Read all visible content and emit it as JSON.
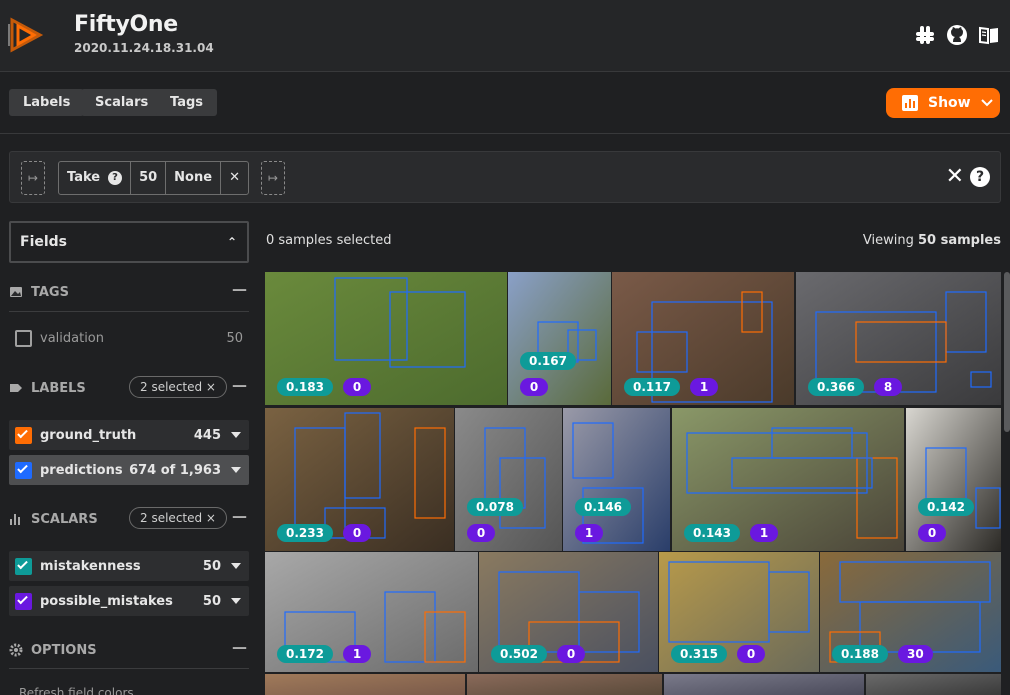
{
  "app": {
    "title": "FiftyOne",
    "version": "2020.11.24.18.31.04"
  },
  "header_icons": [
    "slack-icon",
    "github-icon",
    "docs-book-icon"
  ],
  "toolbar": {
    "labels_tab": "Labels",
    "scalars_tab": "Scalars",
    "tags_tab": "Tags",
    "show_button": "Show"
  },
  "viewbar": {
    "stage_name": "Take",
    "stage_help": "?",
    "stage_value": "50",
    "stage_seed": "None",
    "stage_remove": "✕",
    "add_icon": "↦",
    "close": "✕",
    "help": "?"
  },
  "sidebar": {
    "fields_label": "Fields",
    "tags": {
      "header": "TAGS",
      "items": [
        {
          "label": "validation",
          "count": "50"
        }
      ]
    },
    "labels": {
      "header": "LABELS",
      "badge": "2 selected ×",
      "items": [
        {
          "label": "ground_truth",
          "count": "445",
          "color": "#ff6d04"
        },
        {
          "label": "predictions",
          "count": "674 of 1,963",
          "color": "#1f6bff"
        }
      ]
    },
    "scalars": {
      "header": "SCALARS",
      "badge": "2 selected ×",
      "items": [
        {
          "label": "mistakenness",
          "count": "50",
          "color": "#0e9b98"
        },
        {
          "label": "possible_mistakes",
          "count": "50",
          "color": "#6a18e0"
        }
      ]
    },
    "options": {
      "header": "OPTIONS"
    },
    "refresh": "Refresh field colors"
  },
  "grid": {
    "selected_text": "0 samples selected",
    "viewing_prefix": "Viewing ",
    "viewing_count": "50 samples",
    "tiles": [
      {
        "mistakenness": "0.183",
        "possible_mistakes": "0"
      },
      {
        "mistakenness": "0.167",
        "possible_mistakes": "0"
      },
      {
        "mistakenness": "0.117",
        "possible_mistakes": "1"
      },
      {
        "mistakenness": "0.366",
        "possible_mistakes": "8"
      },
      {
        "mistakenness": "0.233",
        "possible_mistakes": "0"
      },
      {
        "mistakenness": "0.078",
        "possible_mistakes": "0"
      },
      {
        "mistakenness": "0.146",
        "possible_mistakes": "1"
      },
      {
        "mistakenness": "0.143",
        "possible_mistakes": "1"
      },
      {
        "mistakenness": "0.142",
        "possible_mistakes": "0"
      },
      {
        "mistakenness": "0.172",
        "possible_mistakes": "1"
      },
      {
        "mistakenness": "0.502",
        "possible_mistakes": "0"
      },
      {
        "mistakenness": "0.315",
        "possible_mistakes": "0"
      },
      {
        "mistakenness": "0.188",
        "possible_mistakes": "30"
      }
    ]
  },
  "colors": {
    "accent": "#ff6d04",
    "ground_truth": "#ff6d04",
    "predictions": "#1f6bff",
    "mistakenness": "#0e9b98",
    "possible_mistakes": "#6a18e0"
  }
}
